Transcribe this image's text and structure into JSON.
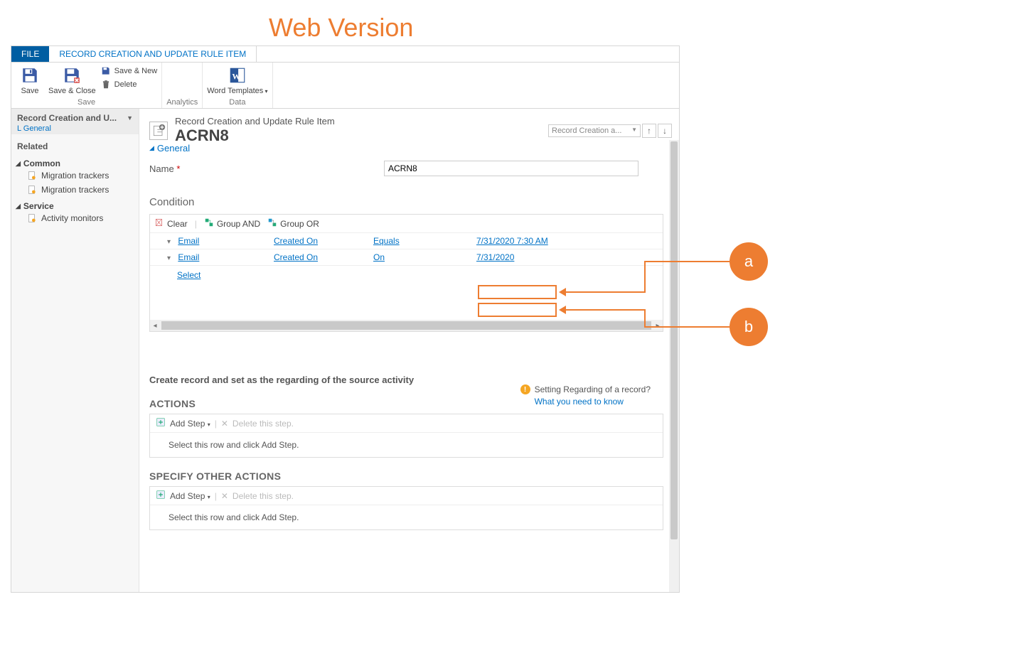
{
  "annotation": {
    "title": "Web Version",
    "bubble_a": "a",
    "bubble_b": "b"
  },
  "tabs": {
    "file": "FILE",
    "rule_item": "RECORD CREATION AND UPDATE RULE ITEM"
  },
  "ribbon": {
    "save": "Save",
    "save_close": "Save & Close",
    "save_new": "Save & New",
    "delete": "Delete",
    "group_save": "Save",
    "analytics": "Analytics",
    "word_templates": "Word Templates",
    "data": "Data"
  },
  "sidebar": {
    "header_title": "Record Creation and U...",
    "header_sub": "L General",
    "related": "Related",
    "common": "Common",
    "migration_trackers": "Migration trackers",
    "service": "Service",
    "activity_monitors": "Activity monitors"
  },
  "header": {
    "entity": "Record Creation and Update Rule Item",
    "record_name": "ACRN8",
    "selector": "Record Creation a..."
  },
  "general": {
    "section": "General",
    "name_label": "Name",
    "name_value": "ACRN8"
  },
  "condition": {
    "heading": "Condition",
    "clear": "Clear",
    "group_and": "Group AND",
    "group_or": "Group OR",
    "rows": [
      {
        "entity": "Email",
        "attribute": "Created On",
        "operator": "Equals",
        "value": "7/31/2020 7:30 AM"
      },
      {
        "entity": "Email",
        "attribute": "Created On",
        "operator": "On",
        "value": "7/31/2020"
      }
    ],
    "select": "Select"
  },
  "create": {
    "heading": "Create record and set as the regarding of the source activity",
    "hint_title": "Setting Regarding of a record?",
    "hint_link": "What you need to know"
  },
  "actions": {
    "heading": "ACTIONS",
    "add_step": "Add Step",
    "delete_step": "Delete this step.",
    "placeholder": "Select this row and click Add Step."
  },
  "other": {
    "heading": "SPECIFY OTHER ACTIONS",
    "add_step": "Add Step",
    "delete_step": "Delete this step.",
    "placeholder": "Select this row and click Add Step."
  }
}
